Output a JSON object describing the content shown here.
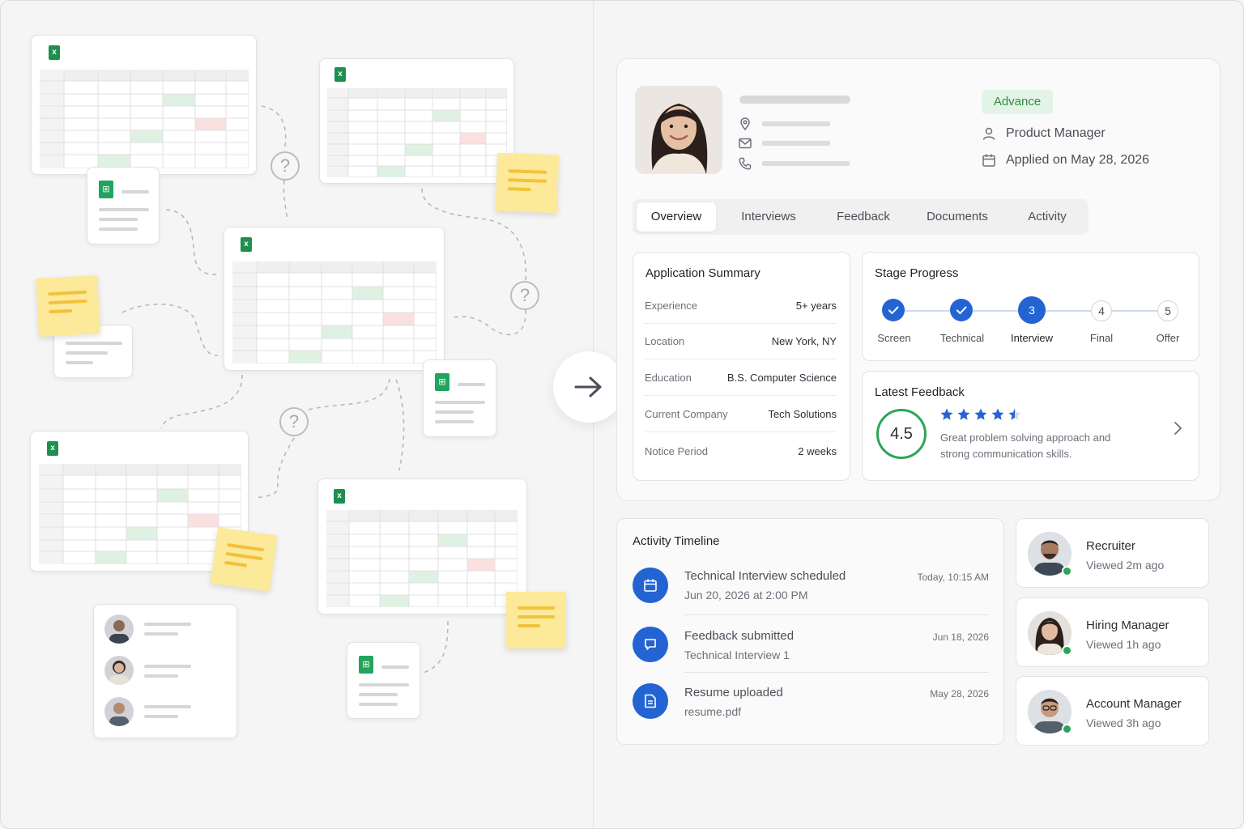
{
  "candidate": {
    "badge": "Advance",
    "role": "Product Manager",
    "applied": "Applied on May 28, 2026"
  },
  "tabs": [
    "Overview",
    "Interviews",
    "Feedback",
    "Documents",
    "Activity"
  ],
  "summary": {
    "title": "Application Summary",
    "rows": [
      {
        "label": "Experience",
        "value": "5+ years"
      },
      {
        "label": "Location",
        "value": "New York, NY"
      },
      {
        "label": "Education",
        "value": "B.S. Computer Science"
      },
      {
        "label": "Current Company",
        "value": "Tech Solutions"
      },
      {
        "label": "Notice Period",
        "value": "2 weeks"
      }
    ]
  },
  "stages": {
    "title": "Stage Progress",
    "items": [
      {
        "num": "1",
        "label": "Screen",
        "state": "done"
      },
      {
        "num": "2",
        "label": "Technical",
        "state": "done"
      },
      {
        "num": "3",
        "label": "Interview",
        "state": "current"
      },
      {
        "num": "4",
        "label": "Final",
        "state": "pending"
      },
      {
        "num": "5",
        "label": "Offer",
        "state": "pending"
      }
    ]
  },
  "feedback": {
    "title": "Latest Feedback",
    "score": "4.5",
    "rating": 4.5,
    "text_line1": "Great problem solving approach and",
    "text_line2": "strong communication skills."
  },
  "timeline": {
    "title": "Activity Timeline",
    "items": [
      {
        "title": "Technical Interview scheduled",
        "sub": "Jun 20, 2026 at 2:00 PM",
        "time": "Today, 10:15 AM",
        "icon": "calendar-icon"
      },
      {
        "title": "Feedback submitted",
        "sub": "Technical Interview 1",
        "time": "Jun 18, 2026",
        "icon": "chat-icon"
      },
      {
        "title": "Resume uploaded",
        "sub": "resume.pdf",
        "time": "May 28, 2026",
        "icon": "document-icon"
      }
    ]
  },
  "viewers": [
    {
      "role": "Recruiter",
      "when": "Viewed 2m ago"
    },
    {
      "role": "Hiring Manager",
      "when": "Viewed 1h ago"
    },
    {
      "role": "Account Manager",
      "when": "Viewed 3h ago"
    }
  ],
  "colors": {
    "accent": "#2364d2",
    "success": "#2aa55a",
    "badge_bg": "#e3f4e6",
    "badge_text": "#2f8a43",
    "note": "#fce99a",
    "sheet_green": "#dff1e3",
    "sheet_red": "#fbe0e0"
  }
}
